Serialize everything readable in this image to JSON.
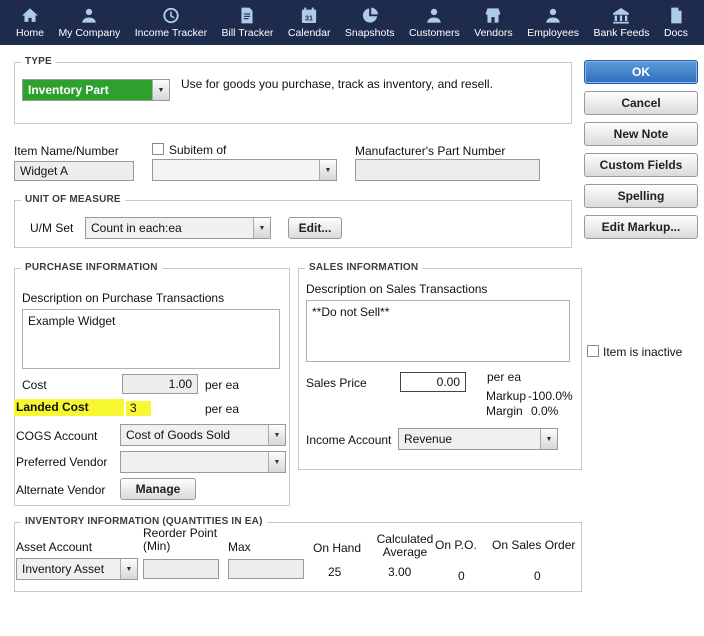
{
  "toolbar": {
    "items": [
      {
        "label": "Home",
        "icon": "home-icon"
      },
      {
        "label": "My Company",
        "icon": "my-company-icon"
      },
      {
        "label": "Income Tracker",
        "icon": "income-tracker-icon"
      },
      {
        "label": "Bill Tracker",
        "icon": "bill-tracker-icon"
      },
      {
        "label": "Calendar",
        "icon": "calendar-icon"
      },
      {
        "label": "Snapshots",
        "icon": "snapshots-icon"
      },
      {
        "label": "Customers",
        "icon": "customers-icon"
      },
      {
        "label": "Vendors",
        "icon": "vendors-icon"
      },
      {
        "label": "Employees",
        "icon": "employees-icon"
      },
      {
        "label": "Bank Feeds",
        "icon": "bank-feeds-icon"
      },
      {
        "label": "Docs",
        "icon": "docs-icon"
      }
    ]
  },
  "type_section": {
    "legend": "TYPE",
    "value": "Inventory Part",
    "description": "Use for goods you purchase, track as inventory, and resell."
  },
  "side_buttons": {
    "ok": "OK",
    "cancel": "Cancel",
    "new_note": "New Note",
    "custom_fields": "Custom Fields",
    "spelling": "Spelling",
    "edit_markup": "Edit Markup..."
  },
  "item": {
    "name_label": "Item Name/Number",
    "name_value": "Widget A",
    "subitem_label": "Subitem of",
    "subitem_value": "",
    "mfr_label": "Manufacturer's Part Number",
    "mfr_value": ""
  },
  "uom": {
    "legend": "UNIT OF MEASURE",
    "set_label": "U/M Set",
    "set_value": "Count in each:ea",
    "edit_button": "Edit..."
  },
  "purchase": {
    "legend": "PURCHASE INFORMATION",
    "desc_label": "Description on Purchase Transactions",
    "desc_value": "Example Widget",
    "cost_label": "Cost",
    "cost_value": "1.00",
    "cost_unit": "per ea",
    "landed_cost_label": "Landed Cost",
    "landed_cost_value": "3",
    "landed_cost_unit": "per ea",
    "cogs_label": "COGS Account",
    "cogs_value": "Cost of Goods Sold",
    "preferred_vendor_label": "Preferred Vendor",
    "preferred_vendor_value": "",
    "alternate_vendor_label": "Alternate Vendor",
    "manage_button": "Manage"
  },
  "sales": {
    "legend": "SALES INFORMATION",
    "desc_label": "Description on Sales Transactions",
    "desc_value": "**Do not Sell**",
    "price_label": "Sales Price",
    "price_value": "0.00",
    "price_unit": "per ea",
    "markup_label": "Markup",
    "markup_value": "-100.0%",
    "margin_label": "Margin",
    "margin_value": "0.0%",
    "income_label": "Income Account",
    "income_value": "Revenue"
  },
  "inactive_label": "Item is inactive",
  "inventory": {
    "legend": "INVENTORY INFORMATION (QUANTITIES IN EA)",
    "asset_label": "Asset Account",
    "asset_value": "Inventory Asset",
    "reorder_label": "Reorder Point (Min)",
    "reorder_value": "",
    "max_label": "Max",
    "max_value": "",
    "on_hand_label": "On Hand",
    "on_hand_value": "25",
    "avg_label": "Calculated Average",
    "avg_value": "3.00",
    "on_po_label": "On P.O.",
    "on_po_value": "0",
    "on_so_label": "On Sales Order",
    "on_so_value": "0"
  },
  "colors": {
    "toolbar_bg": "#1e2b4d",
    "type_green": "#2ea02e",
    "highlight_yellow": "#f8f832",
    "ok_blue": "#2f6ebe"
  }
}
